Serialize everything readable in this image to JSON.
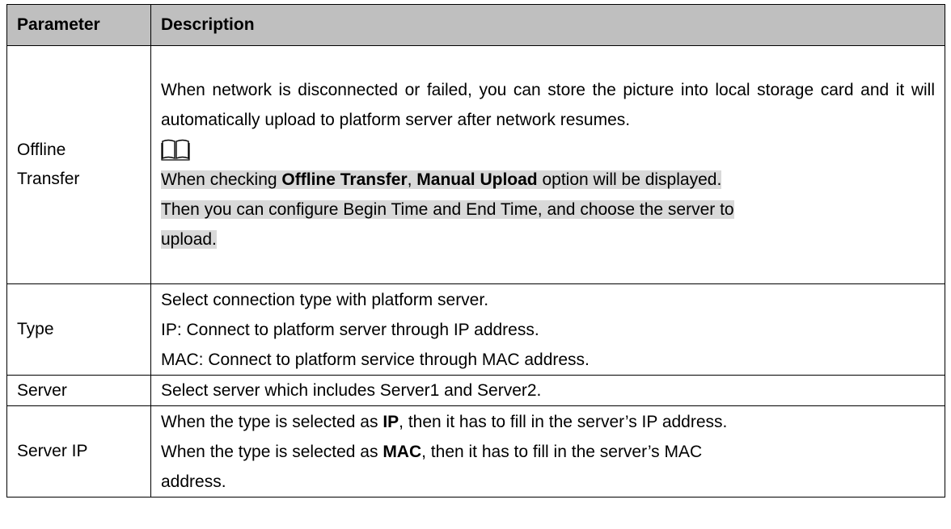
{
  "headers": [
    "Parameter",
    "Description"
  ],
  "rows": {
    "offline": {
      "name": [
        "Offline",
        "Transfer"
      ],
      "para": "When network is disconnected or failed, you can store the picture into local storage card and it will automatically upload to platform server after network resumes.",
      "note_icon": "book-note-icon",
      "note1": {
        "a": "When checking ",
        "b": "Offline Transfer",
        "c": ", ",
        "d": "Manual Upload",
        "e": " option will be displayed."
      },
      "note2": "Then you can configure Begin Time and End Time, and choose the server to",
      "note3": "upload."
    },
    "type": {
      "name": "Type",
      "lines": [
        "Select connection type with platform server.",
        "IP: Connect to platform server through IP address.",
        "MAC: Connect to platform service through MAC address."
      ]
    },
    "server": {
      "name": "Server",
      "desc": "Select server which includes Server1 and Server2."
    },
    "server_ip": {
      "name": "Server IP",
      "line1": {
        "a": "When the type is selected as ",
        "b": "IP",
        "c": ", then it has to fill in the server’s IP address."
      },
      "line2": {
        "a": "When the type is selected as ",
        "b": "MAC",
        "c": ", then it has to fill in the server’s MAC"
      },
      "line3": "address."
    }
  }
}
